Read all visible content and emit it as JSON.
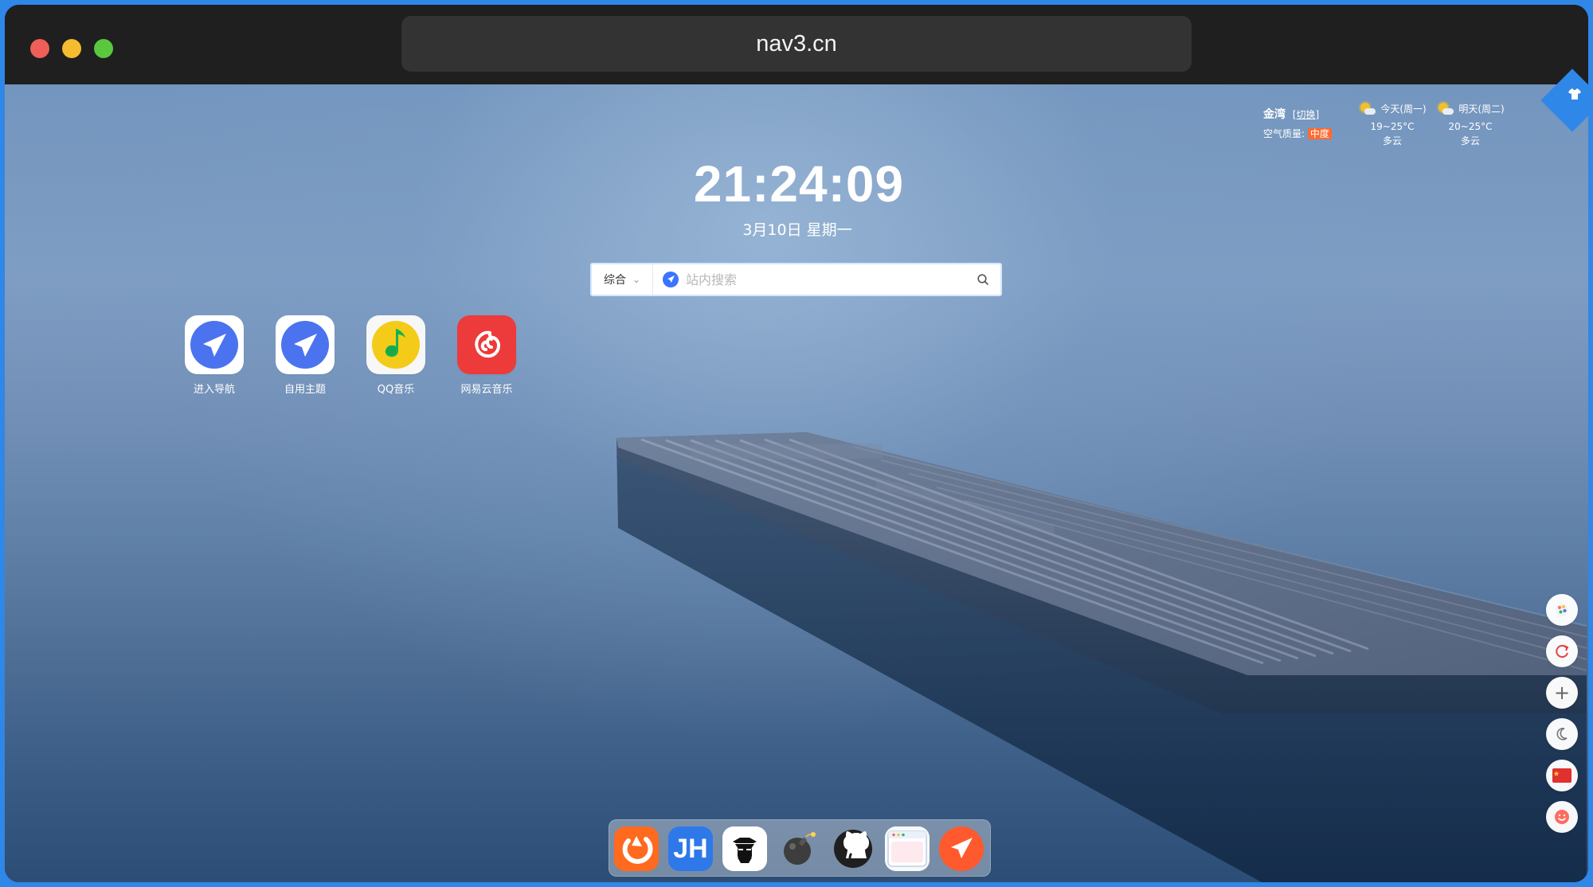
{
  "window": {
    "url": "nav3.cn"
  },
  "clock": {
    "time": "21:24:09",
    "date": "3月10日  星期一"
  },
  "weather": {
    "city": "金湾",
    "switch_label": "[切换]",
    "aqi_label": "空气质量:",
    "aqi_value": "中度",
    "today": {
      "label": "今天(周一)",
      "temp": "19~25°C",
      "condition": "多云"
    },
    "tomorrow": {
      "label": "明天(周二)",
      "temp": "20~25°C",
      "condition": "多云"
    }
  },
  "search": {
    "type_label": "综合",
    "placeholder": "站内搜索",
    "icon": "search-icon"
  },
  "apps": [
    {
      "label": "进入导航",
      "icon": "navigation-arrow-icon"
    },
    {
      "label": "自用主题",
      "icon": "navigation-arrow-icon"
    },
    {
      "label": "QQ音乐",
      "icon": "music-note-icon"
    },
    {
      "label": "网易云音乐",
      "icon": "netease-music-icon"
    }
  ],
  "side_tools": [
    {
      "icon": "theme-palette-icon"
    },
    {
      "icon": "refresh-icon"
    },
    {
      "icon": "plus-icon"
    },
    {
      "icon": "moon-icon"
    },
    {
      "icon": "china-flag-icon"
    },
    {
      "icon": "smile-icon"
    }
  ],
  "dock": [
    {
      "icon": "orange-app-icon"
    },
    {
      "text": "JH",
      "icon": "jh-logo-icon"
    },
    {
      "icon": "spy-icon"
    },
    {
      "icon": "bomb-icon"
    },
    {
      "icon": "github-icon"
    },
    {
      "icon": "browser-window-icon"
    },
    {
      "icon": "navigation-arrow-icon"
    }
  ],
  "colors": {
    "page_border": "#2f87e8",
    "titlebar": "#1f1f1f",
    "url_bg": "#333333",
    "accent_blue": "#4b73f0",
    "qq_yellow": "#f4cb18",
    "netease_red": "#ed3b3b",
    "aqi_orange": "#ff6a2e"
  }
}
